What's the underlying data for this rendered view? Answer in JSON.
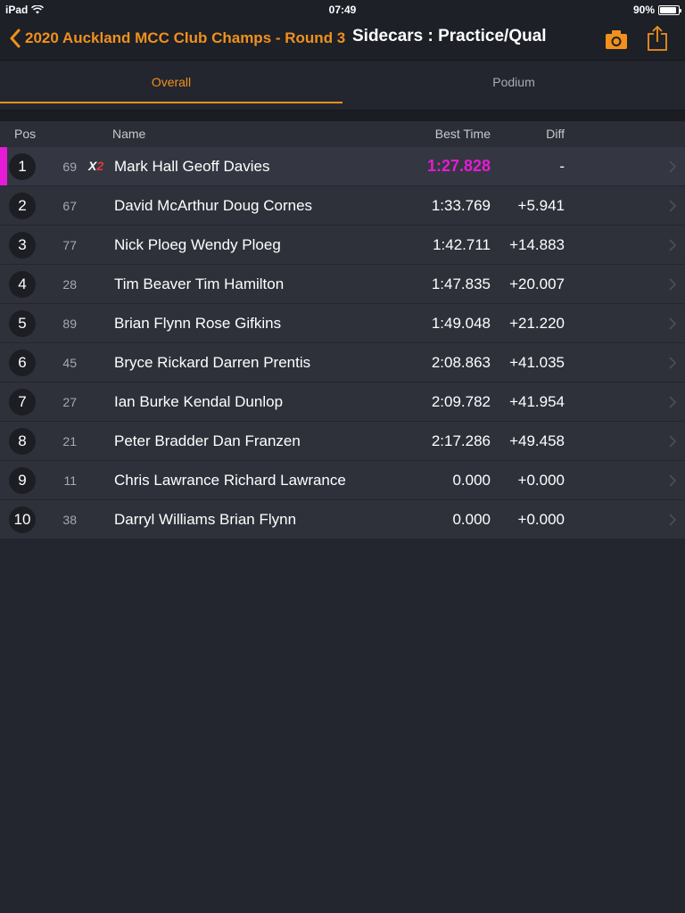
{
  "status_bar": {
    "device": "iPad",
    "time": "07:49",
    "battery": "90%",
    "battery_level": 0.9
  },
  "navbar": {
    "back_label": "2020 Auckland MCC Club Champs - Round 3",
    "title": "Sidecars : Practice/Qual",
    "icons": [
      "camera-icon",
      "share-icon"
    ],
    "accent_color": "#f0901e"
  },
  "tabs": [
    {
      "label": "Overall",
      "selected": true
    },
    {
      "label": "Podium",
      "selected": false
    }
  ],
  "table": {
    "headers": {
      "pos": "Pos",
      "name": "Name",
      "best_time": "Best Time",
      "diff": "Diff"
    },
    "fastest_color": "#e61bd6",
    "rows": [
      {
        "pos": "1",
        "number": "69",
        "badge_x": "X",
        "badge_2": "2",
        "name": "Mark Hall Geoff Davies",
        "best_time": "1:27.828",
        "diff": "-"
      },
      {
        "pos": "2",
        "number": "67",
        "name": "David McArthur Doug Cornes",
        "best_time": "1:33.769",
        "diff": "+5.941"
      },
      {
        "pos": "3",
        "number": "77",
        "name": "Nick Ploeg Wendy Ploeg",
        "best_time": "1:42.711",
        "diff": "+14.883"
      },
      {
        "pos": "4",
        "number": "28",
        "name": "Tim Beaver Tim Hamilton",
        "best_time": "1:47.835",
        "diff": "+20.007"
      },
      {
        "pos": "5",
        "number": "89",
        "name": "Brian Flynn Rose Gifkins",
        "best_time": "1:49.048",
        "diff": "+21.220"
      },
      {
        "pos": "6",
        "number": "45",
        "name": "Bryce Rickard Darren Prentis",
        "best_time": "2:08.863",
        "diff": "+41.035"
      },
      {
        "pos": "7",
        "number": "27",
        "name": "Ian Burke Kendal Dunlop",
        "best_time": "2:09.782",
        "diff": "+41.954"
      },
      {
        "pos": "8",
        "number": "21",
        "name": "Peter Bradder Dan Franzen",
        "best_time": "2:17.286",
        "diff": "+49.458"
      },
      {
        "pos": "9",
        "number": "11",
        "name": "Chris Lawrance Richard Lawrance",
        "best_time": "0.000",
        "diff": "+0.000"
      },
      {
        "pos": "10",
        "number": "38",
        "name": "Darryl Williams Brian Flynn",
        "best_time": "0.000",
        "diff": "+0.000"
      }
    ]
  }
}
